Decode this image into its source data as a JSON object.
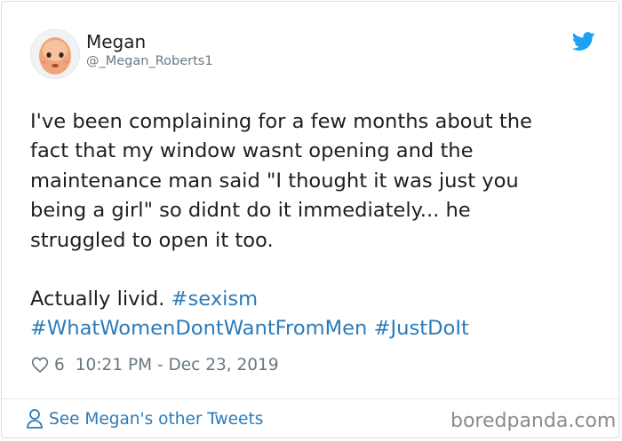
{
  "author": {
    "name": "Megan",
    "handle": "@_Megan_Roberts1",
    "avatar_icon": "avatar-face"
  },
  "tweet": {
    "lines": [
      "I've been complaining for a few months about the",
      "fact that my window wasnt opening and the",
      "maintenance man said \"I thought it was just you",
      "being a girl\" so didnt do it immediately... he",
      "struggled to open it too."
    ],
    "second_para_prefix": "Actually livid.",
    "hashtags": [
      "#sexism",
      "#WhatWomenDontWantFromMen",
      "#JustDoIt"
    ]
  },
  "meta": {
    "likes": "6",
    "timestamp": "10:21 PM - Dec 23, 2019",
    "heart_icon": "heart-outline-icon"
  },
  "footer": {
    "link_label": "See Megan's other Tweets",
    "link_icon": "person-icon"
  },
  "watermark": "boredpanda.com",
  "colors": {
    "link_blue": "#2b7bb9",
    "twitter_blue": "#1da1f2",
    "secondary_text": "#697882",
    "border": "#d9dde2"
  }
}
